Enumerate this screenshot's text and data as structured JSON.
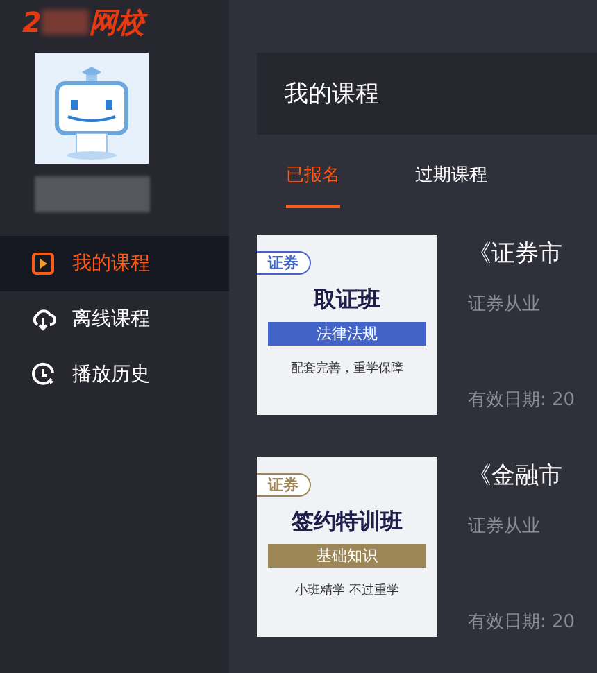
{
  "logo": {
    "prefix": "2",
    "suffix": "网校"
  },
  "sidebar": {
    "items": [
      {
        "label": "我的课程",
        "kind": "play",
        "selected": true
      },
      {
        "label": "离线课程",
        "kind": "cloud",
        "selected": false
      },
      {
        "label": "播放历史",
        "kind": "clock",
        "selected": false
      }
    ]
  },
  "header": {
    "title": "我的课程"
  },
  "tabs": [
    {
      "label": "已报名",
      "selected": true
    },
    {
      "label": "过期课程",
      "selected": false
    }
  ],
  "courses": [
    {
      "thumbnail": {
        "tag": "证券",
        "heading": "取证班",
        "subject": "法律法规",
        "slogan": "配套完善，重学保障",
        "color": "#4264c9"
      },
      "title": "《证券市",
      "category": "证券从业",
      "validity": "有效日期: 20"
    },
    {
      "thumbnail": {
        "tag": "证券",
        "heading": "签约特训班",
        "subject": "基础知识",
        "slogan": "小班精学 不过重学",
        "color": "#9e8756"
      },
      "title": "《金融市",
      "category": "证券从业",
      "validity": "有效日期: 20"
    }
  ]
}
